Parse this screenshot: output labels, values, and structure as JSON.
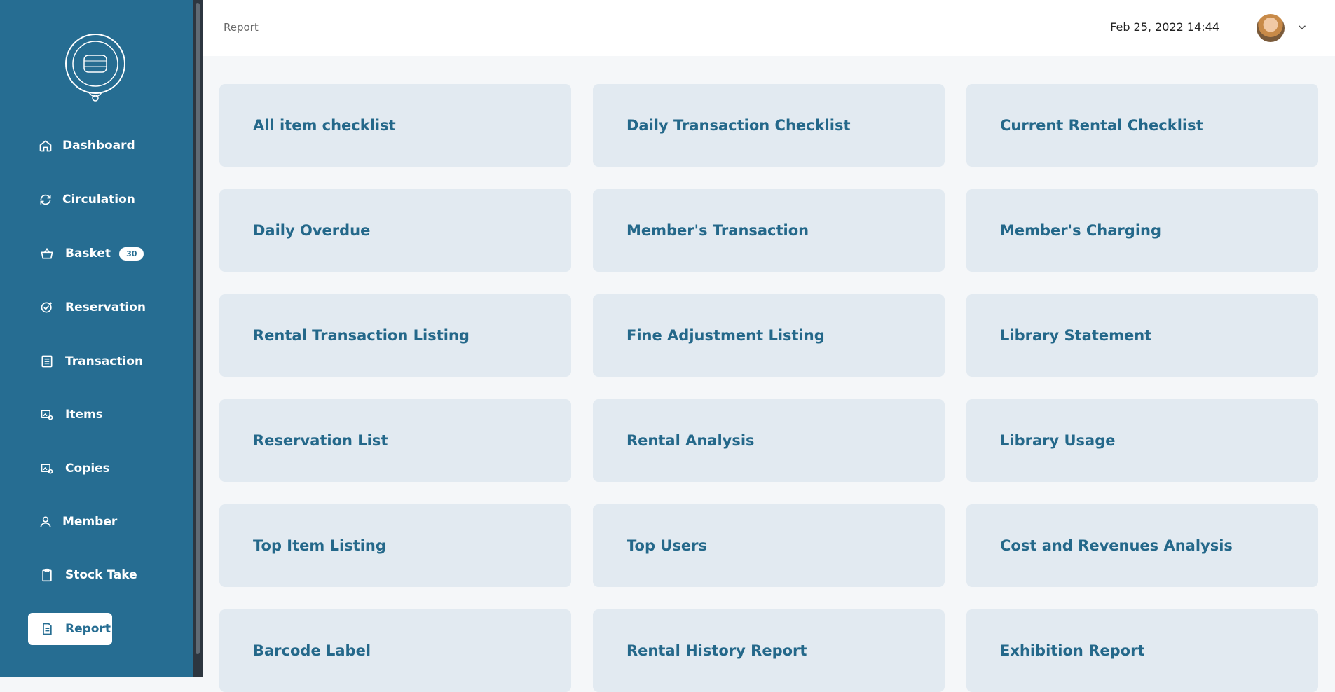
{
  "header": {
    "breadcrumb": "Report",
    "datetime": "Feb 25, 2022 14:44"
  },
  "sidebar": {
    "items": [
      {
        "label": "Dashboard",
        "icon": "home-icon"
      },
      {
        "label": "Circulation",
        "icon": "refresh-icon"
      },
      {
        "label": "Basket",
        "icon": "basket-icon",
        "badge": "30"
      },
      {
        "label": "Reservation",
        "icon": "reservation-icon"
      },
      {
        "label": "Transaction",
        "icon": "list-icon"
      },
      {
        "label": "Items",
        "icon": "items-settings-icon"
      },
      {
        "label": "Copies",
        "icon": "copies-settings-icon"
      },
      {
        "label": "Member",
        "icon": "user-icon"
      },
      {
        "label": "Stock Take",
        "icon": "clipboard-icon"
      },
      {
        "label": "Report",
        "icon": "document-icon",
        "active": true
      }
    ]
  },
  "reports": [
    "All item checklist",
    "Daily Transaction Checklist",
    "Current Rental Checklist",
    "Daily Overdue",
    "Member's Transaction",
    "Member's Charging",
    "Rental Transaction Listing",
    "Fine Adjustment Listing",
    "Library Statement",
    "Reservation List",
    "Rental Analysis",
    "Library Usage",
    "Top Item Listing",
    "Top Users",
    "Cost and Revenues Analysis",
    "Barcode Label",
    "Rental History Report",
    "Exhibition Report"
  ],
  "colors": {
    "sidebar": "#266d92",
    "card": "#e2eaf1",
    "card_text": "#24688a"
  }
}
